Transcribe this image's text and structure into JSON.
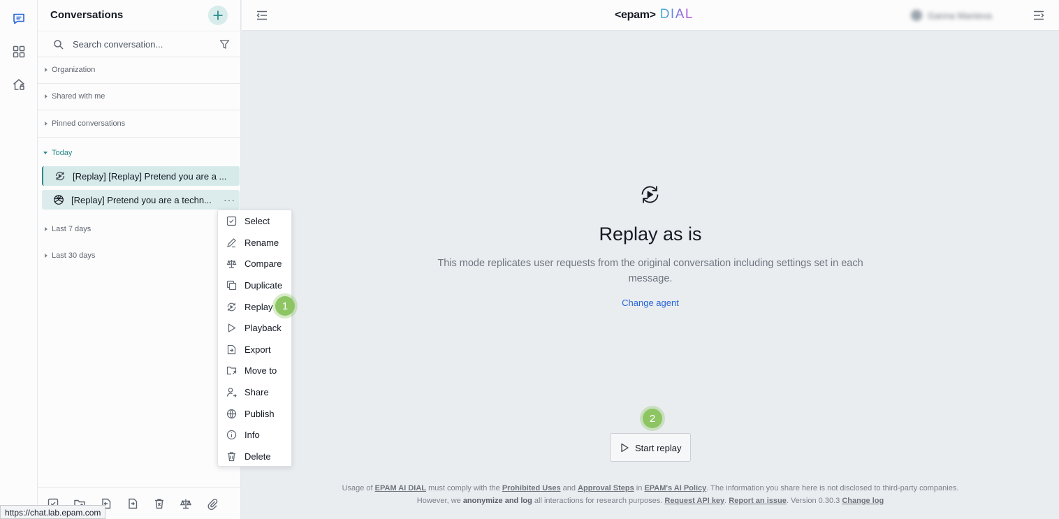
{
  "sidebar": {
    "title": "Conversations",
    "search_placeholder": "Search conversation...",
    "sections": {
      "organization": "Organization",
      "shared": "Shared with me",
      "pinned": "Pinned conversations",
      "today": "Today",
      "last7": "Last 7 days",
      "last30": "Last 30 days"
    },
    "conversations": [
      {
        "title": "[Replay] [Replay] Pretend you are a ...",
        "icon": "replay-icon",
        "state": "active"
      },
      {
        "title": "[Replay] Pretend you are a techn...",
        "icon": "openai-icon",
        "state": "hover",
        "more": "···"
      }
    ],
    "footer_icons": [
      "select-all-icon",
      "new-folder-icon",
      "import-icon",
      "export-icon",
      "delete-icon",
      "compare-icon",
      "attachments-icon"
    ]
  },
  "status_url": "https://chat.lab.epam.com",
  "context_menu": {
    "items": [
      {
        "label": "Select",
        "icon": "checkbox-icon"
      },
      {
        "label": "Rename",
        "icon": "pencil-icon"
      },
      {
        "label": "Compare",
        "icon": "scales-icon"
      },
      {
        "label": "Duplicate",
        "icon": "copy-icon"
      },
      {
        "label": "Replay",
        "icon": "replay-icon"
      },
      {
        "label": "Playback",
        "icon": "play-icon"
      },
      {
        "label": "Export",
        "icon": "file-export-icon"
      },
      {
        "label": "Move to",
        "icon": "folder-move-icon"
      },
      {
        "label": "Share",
        "icon": "user-share-icon"
      },
      {
        "label": "Publish",
        "icon": "globe-icon"
      },
      {
        "label": "Info",
        "icon": "info-icon"
      },
      {
        "label": "Delete",
        "icon": "trash-icon"
      }
    ]
  },
  "callouts": {
    "step1": "1",
    "step2": "2",
    "color": "#8dc563"
  },
  "header": {
    "logo_epam": "<epam>",
    "logo_dial": "DIAL",
    "user_name": "Ganna Manieva"
  },
  "main": {
    "title": "Replay as is",
    "description": "This mode replicates user requests from the original conversation including settings set in each message.",
    "change_agent": "Change agent",
    "start_button": "Start replay"
  },
  "footer": {
    "t1": "Usage of ",
    "l1": "EPAM AI DIAL",
    "t2": " must comply with the ",
    "l2": "Prohibited Uses",
    "t3": " and ",
    "l3": "Approval Steps",
    "t4": " in ",
    "l4": "EPAM's AI Policy",
    "t5": ". The information you share here is not disclosed to third-party companies.",
    "t6": "However, we ",
    "b1": "anonymize and log",
    "t7": " all interactions for research purposes. ",
    "l5": "Request API key",
    "t8": ". ",
    "l6": "Report an issue",
    "t9": ". Version 0.30.3 ",
    "l7": "Change log"
  },
  "colors": {
    "accent": "#2b8a8a",
    "link": "#2764d9",
    "background": "#eaedf0"
  }
}
